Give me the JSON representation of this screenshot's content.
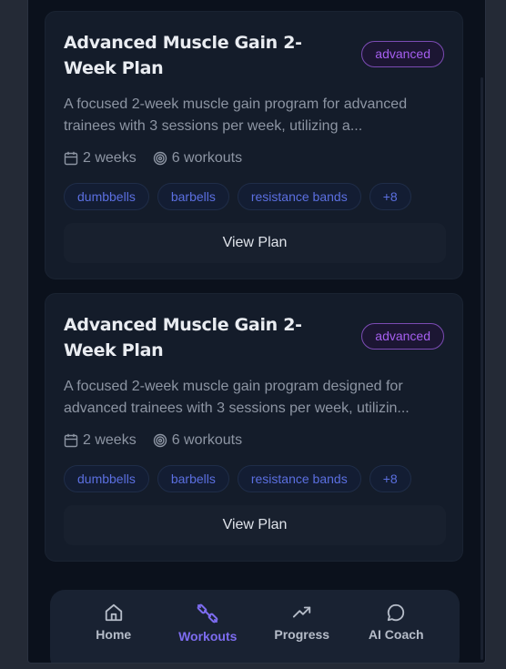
{
  "plans": [
    {
      "title": "Advanced Muscle Gain 2-Week Plan",
      "level": "advanced",
      "description": "A focused 2-week muscle gain program for advanced trainees with 3 sessions per week, utilizing a...",
      "duration": "2 weeks",
      "workouts": "6 workouts",
      "equipment": [
        "dumbbells",
        "barbells",
        "resistance bands"
      ],
      "more_count": "+8",
      "button_label": "View Plan"
    },
    {
      "title": "Advanced Muscle Gain 2-Week Plan",
      "level": "advanced",
      "description": "A focused 2-week muscle gain program designed for advanced trainees with 3 sessions per week, utilizin...",
      "duration": "2 weeks",
      "workouts": "6 workouts",
      "equipment": [
        "dumbbells",
        "barbells",
        "resistance bands"
      ],
      "more_count": "+8",
      "button_label": "View Plan"
    }
  ],
  "nav": {
    "items": [
      {
        "label": "Home",
        "icon": "home-icon"
      },
      {
        "label": "Workouts",
        "icon": "dumbbell-icon",
        "active": true
      },
      {
        "label": "Progress",
        "icon": "trending-up-icon"
      },
      {
        "label": "AI Coach",
        "icon": "chat-bubble-icon"
      }
    ]
  },
  "colors": {
    "accent": "#7d6cf0",
    "badge": "#a55ff0",
    "tag": "#5b6fe0",
    "background": "#0b111c",
    "card": "#141c2a"
  }
}
